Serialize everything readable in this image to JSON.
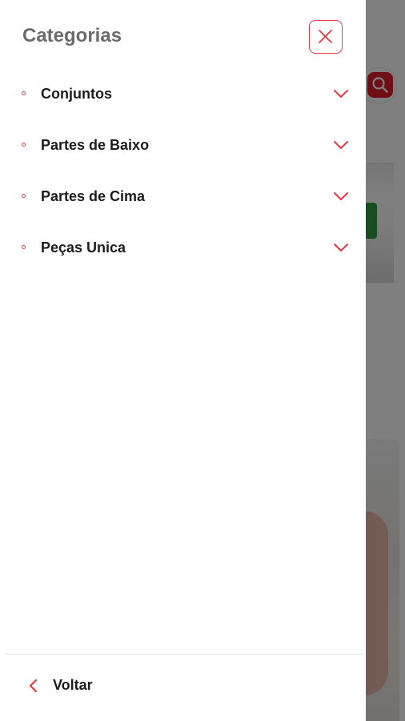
{
  "drawer": {
    "title": "Categorias",
    "close_icon": "close-icon",
    "categories": [
      {
        "label": "Conjuntos",
        "icon": "chevron-down-icon"
      },
      {
        "label": "Partes de Baixo",
        "icon": "chevron-down-icon"
      },
      {
        "label": "Partes de Cima",
        "icon": "chevron-down-icon"
      },
      {
        "label": "Peças Unica",
        "icon": "chevron-down-icon"
      }
    ],
    "back": {
      "label": "Voltar",
      "icon": "chevron-left-icon"
    }
  },
  "background": {
    "search_icon": "search-icon"
  },
  "colors": {
    "accent": "#e53945",
    "title": "#6b6b6b",
    "text": "#1c1c1c",
    "overlay": "rgba(0,0,0,0.5)"
  }
}
